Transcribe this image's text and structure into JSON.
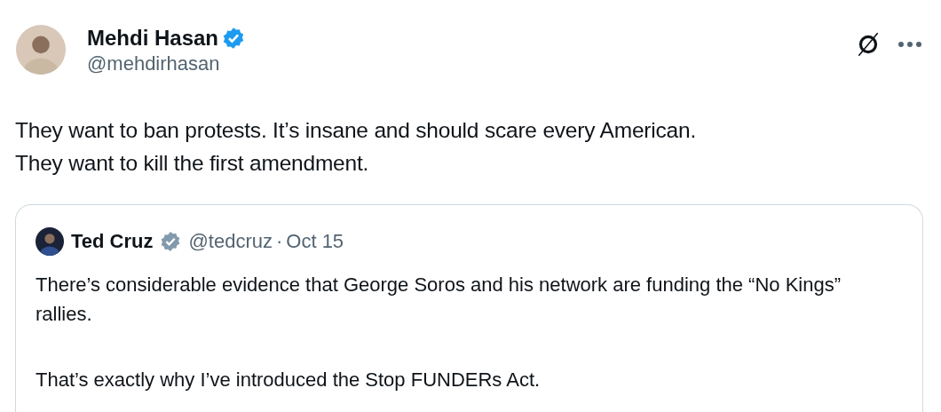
{
  "author": {
    "name": "Mehdi Hasan",
    "verified": true,
    "color": "#1d9bf0",
    "handle": "@mehdirhasan"
  },
  "actions": [
    {
      "kind": "grok"
    },
    {
      "kind": "more"
    }
  ],
  "text": [
    "They want to ban protests. It’s insane and should scare every American.",
    "They want to kill the first amendment."
  ],
  "quote": {
    "author": {
      "name": "Ted Cruz",
      "verified": true,
      "color": "#829aab",
      "handle": "@tedcruz",
      "separator": "·",
      "date": "Oct 15"
    },
    "paragraphs": [
      "There’s considerable evidence that George Soros and his network are funding the “No Kings” rallies.",
      "That’s exactly why I’ve introduced the Stop FUNDERs Act."
    ]
  }
}
